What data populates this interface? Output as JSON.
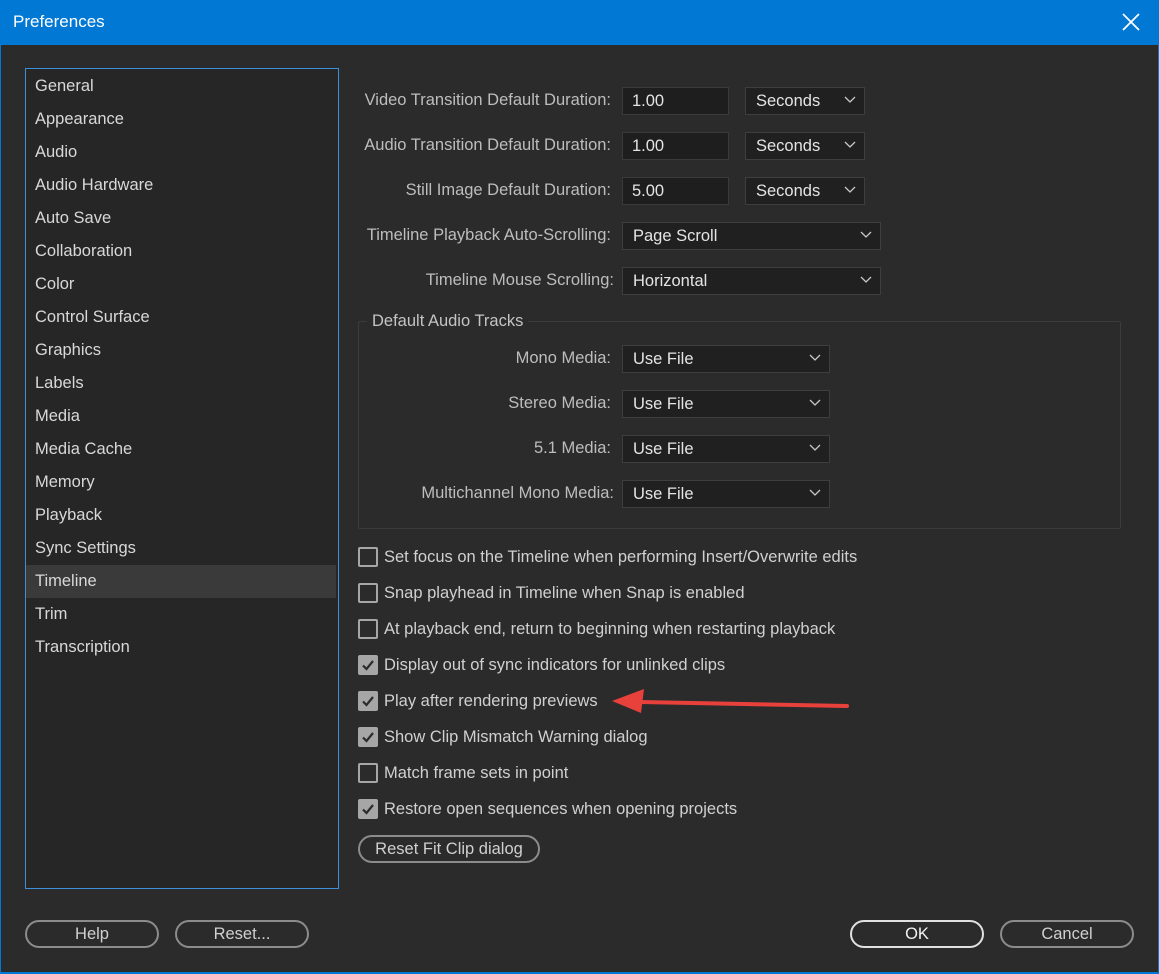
{
  "window": {
    "title": "Preferences"
  },
  "sidebar": {
    "items": [
      {
        "label": "General"
      },
      {
        "label": "Appearance"
      },
      {
        "label": "Audio"
      },
      {
        "label": "Audio Hardware"
      },
      {
        "label": "Auto Save"
      },
      {
        "label": "Collaboration"
      },
      {
        "label": "Color"
      },
      {
        "label": "Control Surface"
      },
      {
        "label": "Graphics"
      },
      {
        "label": "Labels"
      },
      {
        "label": "Media"
      },
      {
        "label": "Media Cache"
      },
      {
        "label": "Memory"
      },
      {
        "label": "Playback"
      },
      {
        "label": "Sync Settings"
      },
      {
        "label": "Timeline"
      },
      {
        "label": "Trim"
      },
      {
        "label": "Transcription"
      }
    ],
    "selected": "Timeline"
  },
  "durations": [
    {
      "label": "Video Transition Default Duration:",
      "value": "1.00",
      "unit": "Seconds"
    },
    {
      "label": "Audio Transition Default Duration:",
      "value": "1.00",
      "unit": "Seconds"
    },
    {
      "label": "Still Image Default Duration:",
      "value": "5.00",
      "unit": "Seconds"
    }
  ],
  "scrolling": [
    {
      "label": "Timeline Playback Auto-Scrolling:",
      "value": "Page Scroll"
    },
    {
      "label": "Timeline Mouse Scrolling:",
      "value": "Horizontal"
    }
  ],
  "audio_tracks": {
    "title": "Default Audio Tracks",
    "rows": [
      {
        "label": "Mono Media:",
        "value": "Use File"
      },
      {
        "label": "Stereo Media:",
        "value": "Use File"
      },
      {
        "label": "5.1 Media:",
        "value": "Use File"
      },
      {
        "label": "Multichannel Mono Media:",
        "value": "Use File"
      }
    ]
  },
  "checkboxes": [
    {
      "label": "Set focus on the Timeline when performing Insert/Overwrite edits",
      "checked": false
    },
    {
      "label": "Snap playhead in Timeline when Snap is enabled",
      "checked": false
    },
    {
      "label": "At playback end, return to beginning when restarting playback",
      "checked": false
    },
    {
      "label": "Display out of sync indicators for unlinked clips",
      "checked": true
    },
    {
      "label": "Play after rendering previews",
      "checked": true
    },
    {
      "label": "Show Clip Mismatch Warning dialog",
      "checked": true
    },
    {
      "label": "Match frame sets in point",
      "checked": false
    },
    {
      "label": "Restore open sequences when opening projects",
      "checked": true
    }
  ],
  "reset_fit_clip_label": "Reset Fit Clip dialog",
  "footer": {
    "help": "Help",
    "reset": "Reset...",
    "ok": "OK",
    "cancel": "Cancel"
  },
  "colors": {
    "accent": "#0078d4",
    "annotation_arrow": "#e8413c"
  }
}
